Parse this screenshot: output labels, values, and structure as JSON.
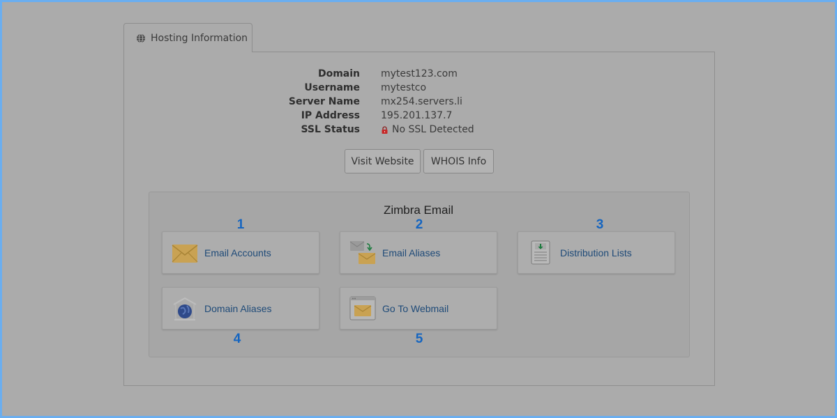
{
  "tab": {
    "label": "Hosting Information",
    "icon": "globe-icon"
  },
  "hosting": {
    "rows": [
      {
        "label": "Domain",
        "value": "mytest123.com"
      },
      {
        "label": "Username",
        "value": "mytestco"
      },
      {
        "label": "Server Name",
        "value": "mx254.servers.li"
      },
      {
        "label": "IP Address",
        "value": "195.201.137.7"
      },
      {
        "label": "SSL Status",
        "value": "No SSL Detected"
      }
    ]
  },
  "buttons": {
    "visit": "Visit Website",
    "whois": "WHOIS Info"
  },
  "email": {
    "title": "Zimbra Email",
    "tiles": [
      {
        "label": "Email Accounts",
        "icon": "envelope-icon",
        "number": "1"
      },
      {
        "label": "Email Aliases",
        "icon": "envelope-forward-icon",
        "number": "2"
      },
      {
        "label": "Distribution Lists",
        "icon": "document-download-icon",
        "number": "3"
      },
      {
        "label": "Domain Aliases",
        "icon": "domain-globe-icon",
        "number": "4"
      },
      {
        "label": "Go To Webmail",
        "icon": "webmail-window-icon",
        "number": "5"
      }
    ]
  },
  "colors": {
    "overlay": "#ababab",
    "border_highlight": "#6aaef0",
    "link": "#1e4a78",
    "number": "#1565c0",
    "lock": "#c62828"
  }
}
